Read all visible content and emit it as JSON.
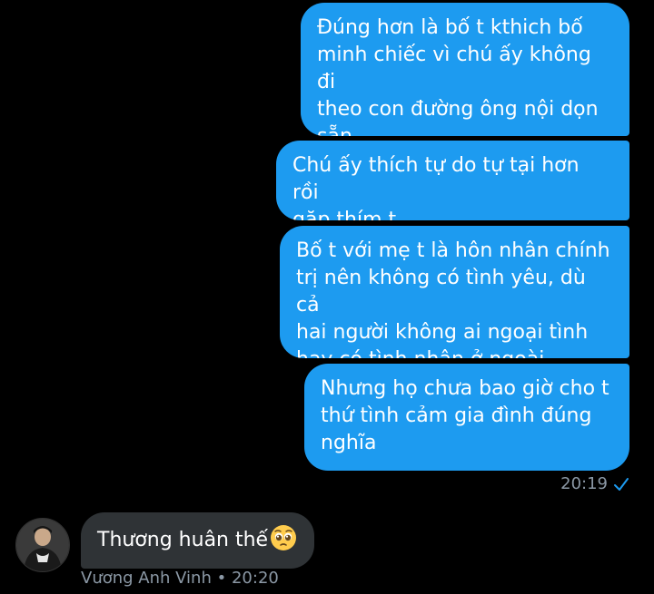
{
  "thread": {
    "outgoing": [
      {
        "text": "Đúng hơn là bố t kthich bố\nminh chiếc vì chú ấy không đi\ntheo con đường ông nội dọn\nsẵn"
      },
      {
        "text": "Chú ấy thích tự do tự tại hơn rồi\ngặp thím t"
      },
      {
        "text": "Bố t với mẹ t là hôn nhân chính\ntrị nên không có tình yêu, dù cả\nhai người không ai ngoại tình\nhay có tình nhân ở ngoài"
      },
      {
        "text": "Nhưng họ chưa bao giờ cho t\nthứ tình cảm gia đình đúng\nnghĩa"
      }
    ],
    "outgoing_time": "20:19",
    "outgoing_status_icon": "read-check-icon",
    "incoming": {
      "text": "Thương huân thế",
      "emoji_icon": "pleading-face-emoji",
      "sender": "Vương Anh Vinh",
      "separator": "•",
      "time": "20:20",
      "avatar_icon": "user-avatar"
    }
  },
  "colors": {
    "background": "#000000",
    "outgoing_bubble": "#1d9bf0",
    "incoming_bubble": "#2f3336",
    "meta_text": "#8b98a5"
  }
}
